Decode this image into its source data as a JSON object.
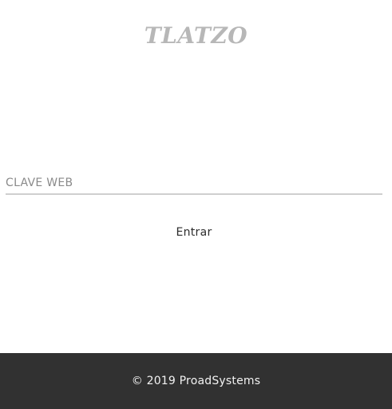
{
  "header": {
    "logo_text": "TLATZO"
  },
  "login": {
    "password_field": {
      "placeholder": "CLAVE WEB",
      "value": ""
    },
    "submit_label": "Entrar"
  },
  "footer": {
    "text": "© 2019 ProadSystems"
  },
  "colors": {
    "background": "#ffffff",
    "logo": "#b7b7b7",
    "field_underline": "#cfcfcf",
    "footer_background": "#313131",
    "footer_text": "#f2f2f2"
  }
}
